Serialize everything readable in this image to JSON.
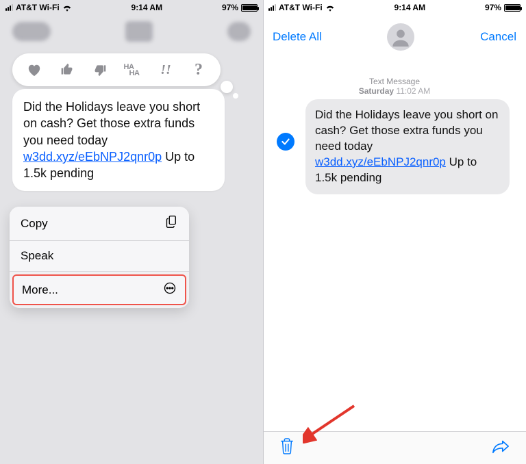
{
  "status": {
    "carrier": "AT&T Wi-Fi",
    "time": "9:14 AM",
    "battery_pct": "97%"
  },
  "message": {
    "text1": "Did the Holidays leave you short on cash? Get those extra funds you need today ",
    "link": "w3dd.xyz/eEbNPJ2qnr0p",
    "text2": " Up to 1.5k pending"
  },
  "tapback": {
    "heart": "❤",
    "thumbs_up": "👍",
    "thumbs_down": "👎",
    "haha_top": "HA",
    "haha_bot": "HA",
    "exclaim": "!!",
    "question": "?"
  },
  "action_sheet": {
    "copy": "Copy",
    "speak": "Speak",
    "more": "More..."
  },
  "right_header": {
    "delete_all": "Delete All",
    "cancel": "Cancel"
  },
  "meta": {
    "kind": "Text Message",
    "day": "Saturday",
    "time": "11:02 AM"
  }
}
